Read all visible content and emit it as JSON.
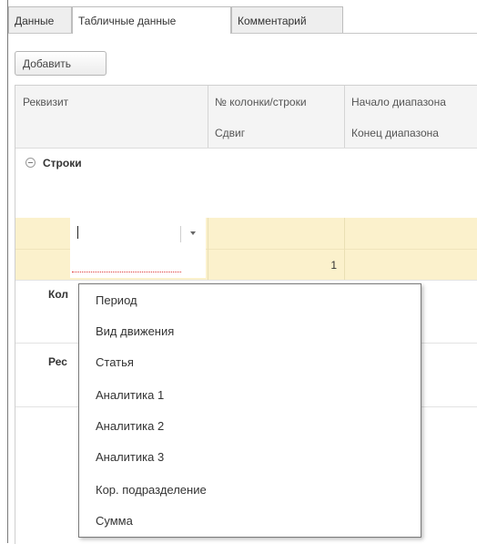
{
  "tabs": [
    {
      "label": "Данные",
      "active": false
    },
    {
      "label": "Табличные данные",
      "active": true
    },
    {
      "label": "Комментарий",
      "active": false
    }
  ],
  "toolbar": {
    "add_label": "Добавить"
  },
  "table": {
    "header_row1": [
      "Реквизит",
      "№ колонки/строки",
      "Начало диапазона"
    ],
    "header_row2": [
      "",
      "Сдвиг",
      "Конец диапазона"
    ],
    "group_label": "Строки",
    "edit_row": {
      "input_value": "",
      "column_value": "1"
    },
    "row_labels": [
      "Кол",
      "Рес"
    ]
  },
  "dropdown": {
    "items": [
      "Период",
      "Вид движения",
      "Статья",
      "Аналитика 1",
      "Аналитика 2",
      "Аналитика 3",
      "Кор. подразделение",
      "Сумма"
    ]
  },
  "colors": {
    "highlight_row": "#fbf1cc",
    "header_bg": "#f4f4f4"
  }
}
